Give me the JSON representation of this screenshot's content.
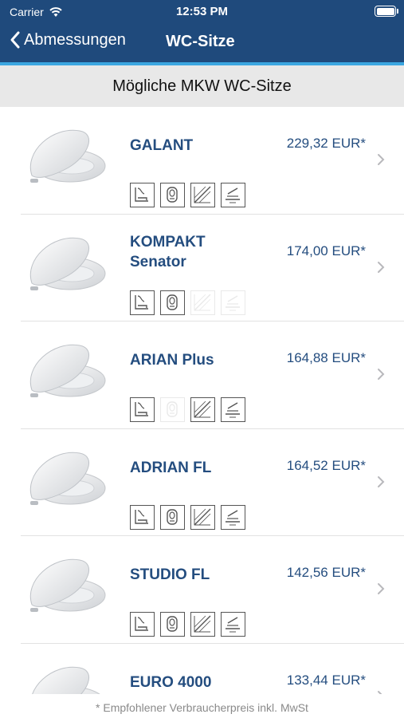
{
  "status_bar": {
    "carrier": "Carrier",
    "time": "12:53 PM"
  },
  "nav": {
    "back_label": "Abmessungen",
    "title": "WC-Sitze"
  },
  "section_header": "Mögliche MKW WC-Sitze",
  "colors": {
    "nav_background": "#1f4a7c",
    "accent": "#3ba6e0",
    "text_blue": "#244d7f"
  },
  "products": [
    {
      "name": "GALANT",
      "price": "229,32 EUR*",
      "features": [
        true,
        true,
        true,
        true
      ]
    },
    {
      "name": "KOMPAKT Senator",
      "name_line1": "KOMPAKT",
      "name_line2": "Senator",
      "price": "174,00 EUR*",
      "features": [
        true,
        true,
        false,
        false
      ]
    },
    {
      "name": "ARIAN Plus",
      "price": "164,88 EUR*",
      "features": [
        true,
        false,
        true,
        true
      ]
    },
    {
      "name": "ADRIAN FL",
      "price": "164,52 EUR*",
      "features": [
        true,
        true,
        true,
        true
      ]
    },
    {
      "name": "STUDIO FL",
      "price": "142,56 EUR*",
      "features": [
        true,
        true,
        true,
        true
      ]
    },
    {
      "name": "EURO 4000",
      "price": "133,44 EUR*",
      "features": [
        true,
        true,
        true,
        true
      ]
    }
  ],
  "feature_icons": [
    "seat-profile-icon",
    "wc-bowl-icon",
    "diagonal-surface-icon",
    "lid-lift-icon"
  ],
  "footer_note": "* Empfohlener Verbraucherpreis inkl. MwSt"
}
